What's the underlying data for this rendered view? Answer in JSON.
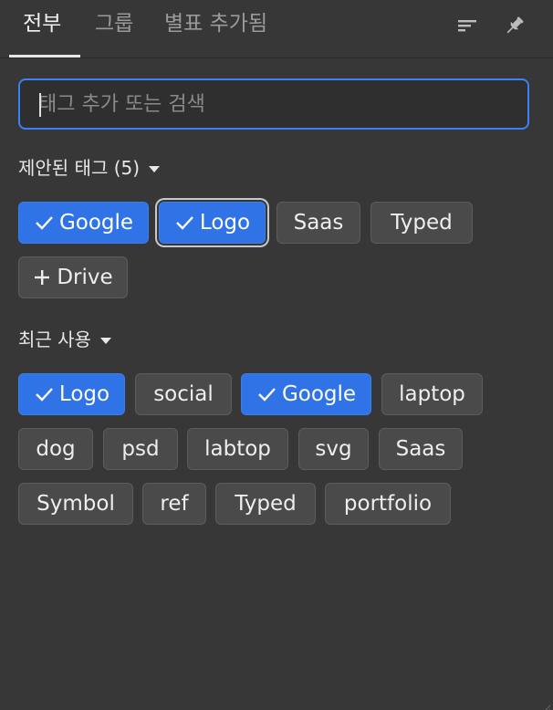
{
  "tabs": {
    "all": "전부",
    "group": "그룹",
    "starred": "별표 추가됨"
  },
  "toolbar": {
    "sort_icon": "sort-icon",
    "pin_icon": "pin-icon"
  },
  "search": {
    "placeholder": "태그 추가 또는 검색",
    "value": ""
  },
  "suggested": {
    "header": "제안된 태그 (5)",
    "chips": [
      {
        "label": "Google",
        "state": "selected",
        "icon": "check-icon"
      },
      {
        "label": "Logo",
        "state": "selected",
        "icon": "check-icon"
      },
      {
        "label": "Saas",
        "state": "normal"
      },
      {
        "label": "Typed",
        "state": "normal"
      },
      {
        "label": "Drive",
        "state": "add",
        "icon": "plus-icon"
      }
    ]
  },
  "recent": {
    "header": "최근 사용",
    "chips": [
      {
        "label": "Logo",
        "state": "selected",
        "icon": "check-icon"
      },
      {
        "label": "social",
        "state": "normal"
      },
      {
        "label": "Google",
        "state": "selected",
        "icon": "check-icon"
      },
      {
        "label": "laptop",
        "state": "normal"
      },
      {
        "label": "dog",
        "state": "normal"
      },
      {
        "label": "psd",
        "state": "normal"
      },
      {
        "label": "labtop",
        "state": "normal"
      },
      {
        "label": "svg",
        "state": "normal"
      },
      {
        "label": "Saas",
        "state": "normal"
      },
      {
        "label": "Symbol",
        "state": "normal"
      },
      {
        "label": "ref",
        "state": "normal"
      },
      {
        "label": "Typed",
        "state": "normal"
      },
      {
        "label": "portfolio",
        "state": "normal"
      }
    ]
  },
  "colors": {
    "background": "#373737",
    "accent": "#2f73e6",
    "chip": "#4a4a4a"
  }
}
